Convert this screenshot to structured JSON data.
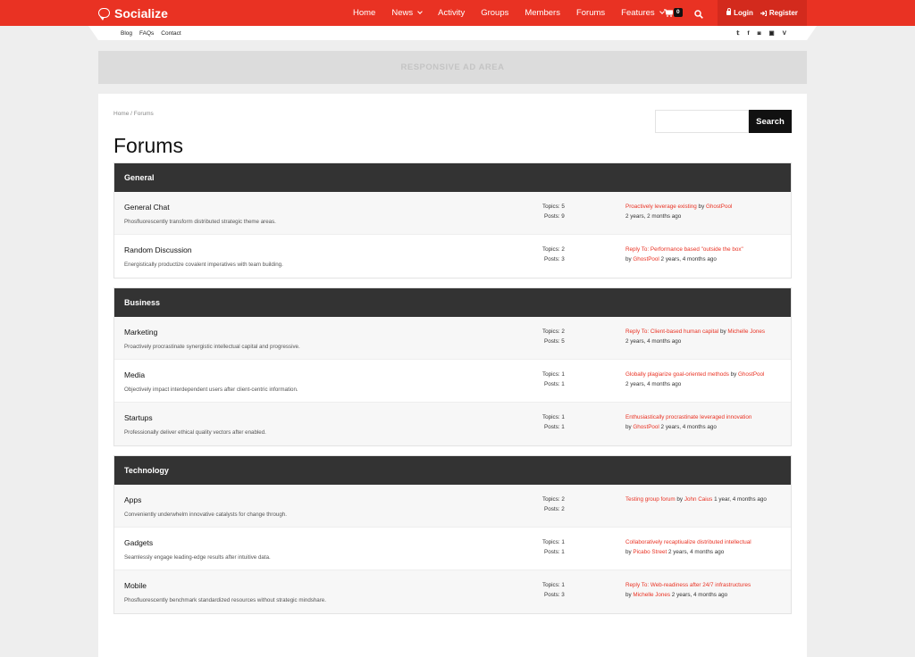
{
  "brand": {
    "name": "Socialize",
    "accent": "#e93223",
    "dark": "#333333"
  },
  "nav": {
    "items": [
      "Home",
      "News",
      "Activity",
      "Groups",
      "Members",
      "Forums",
      "Features"
    ],
    "cart_count": "0",
    "login": "Login",
    "register": "Register"
  },
  "subnav": {
    "items": [
      "Blog",
      "FAQs",
      "Contact"
    ],
    "social": [
      "twitter",
      "facebook",
      "instagram",
      "youtube",
      "vine"
    ]
  },
  "ad": {
    "label": "RESPONSIVE AD AREA"
  },
  "breadcrumb": "Home / Forums",
  "search": {
    "placeholder": "",
    "button": "Search"
  },
  "page_title": "Forums",
  "groups": [
    {
      "name": "General",
      "forums": [
        {
          "title": "General Chat",
          "desc": "Phosfluorescently transform distributed strategic theme areas.",
          "topics": "Topics: 5",
          "posts": "Posts: 9",
          "last_link": "Proactively leverage existing",
          "last_by_pre": " by ",
          "last_user": "GhostPool",
          "last_time": "2 years, 2 months ago"
        },
        {
          "title": "Random Discussion",
          "desc": "Energistically productize covalent imperatives with team building.",
          "topics": "Topics: 2",
          "posts": "Posts: 3",
          "last_link": "Reply To: Performance based \"outside the box\"",
          "last_by_pre": "by ",
          "last_user": "GhostPool",
          "last_time": " 2 years, 4 months ago"
        }
      ]
    },
    {
      "name": "Business",
      "forums": [
        {
          "title": "Marketing",
          "desc": "Proactively procrastinate synergistic intellectual capital and progressive.",
          "topics": "Topics: 2",
          "posts": "Posts: 5",
          "last_link": "Reply To: Client-based human capital",
          "last_by_pre": " by ",
          "last_user": "Michelle Jones",
          "last_time": "2 years, 4 months ago"
        },
        {
          "title": "Media",
          "desc": "Objectively impact interdependent users after client-centric information.",
          "topics": "Topics: 1",
          "posts": "Posts: 1",
          "last_link": "Globally plagiarize goal-oriented methods",
          "last_by_pre": " by ",
          "last_user": "GhostPool",
          "last_time": "2 years, 4 months ago"
        },
        {
          "title": "Startups",
          "desc": "Professionally deliver ethical quality vectors after enabled.",
          "topics": "Topics: 1",
          "posts": "Posts: 1",
          "last_link": "Enthusiastically procrastinate leveraged innovation",
          "last_by_pre": "by ",
          "last_user": "GhostPool",
          "last_time": " 2 years, 4 months ago"
        }
      ]
    },
    {
      "name": "Technology",
      "forums": [
        {
          "title": "Apps",
          "desc": "Conveniently underwhelm innovative catalysts for change through.",
          "topics": "Topics: 2",
          "posts": "Posts: 2",
          "last_link": "Testing group forum",
          "last_by_pre": " by ",
          "last_user": "John Caius",
          "last_time": " 1 year, 4 months ago"
        },
        {
          "title": "Gadgets",
          "desc": "Seamlessly engage leading-edge results after intuitive data.",
          "topics": "Topics: 1",
          "posts": "Posts: 1",
          "last_link": "Collaboratively recaptiualize distributed intellectual",
          "last_by_pre": "by ",
          "last_user": "Picabo Street",
          "last_time": " 2 years, 4 months ago"
        },
        {
          "title": "Mobile",
          "desc": "Phosfluorescently benchmark standardized resources without strategic mindshare.",
          "topics": "Topics: 1",
          "posts": "Posts: 3",
          "last_link": "Reply To: Web-readiness after 24/7 infrastructures",
          "last_by_pre": "by ",
          "last_user": "Michelle Jones",
          "last_time": " 2 years, 4 months ago"
        }
      ]
    }
  ]
}
